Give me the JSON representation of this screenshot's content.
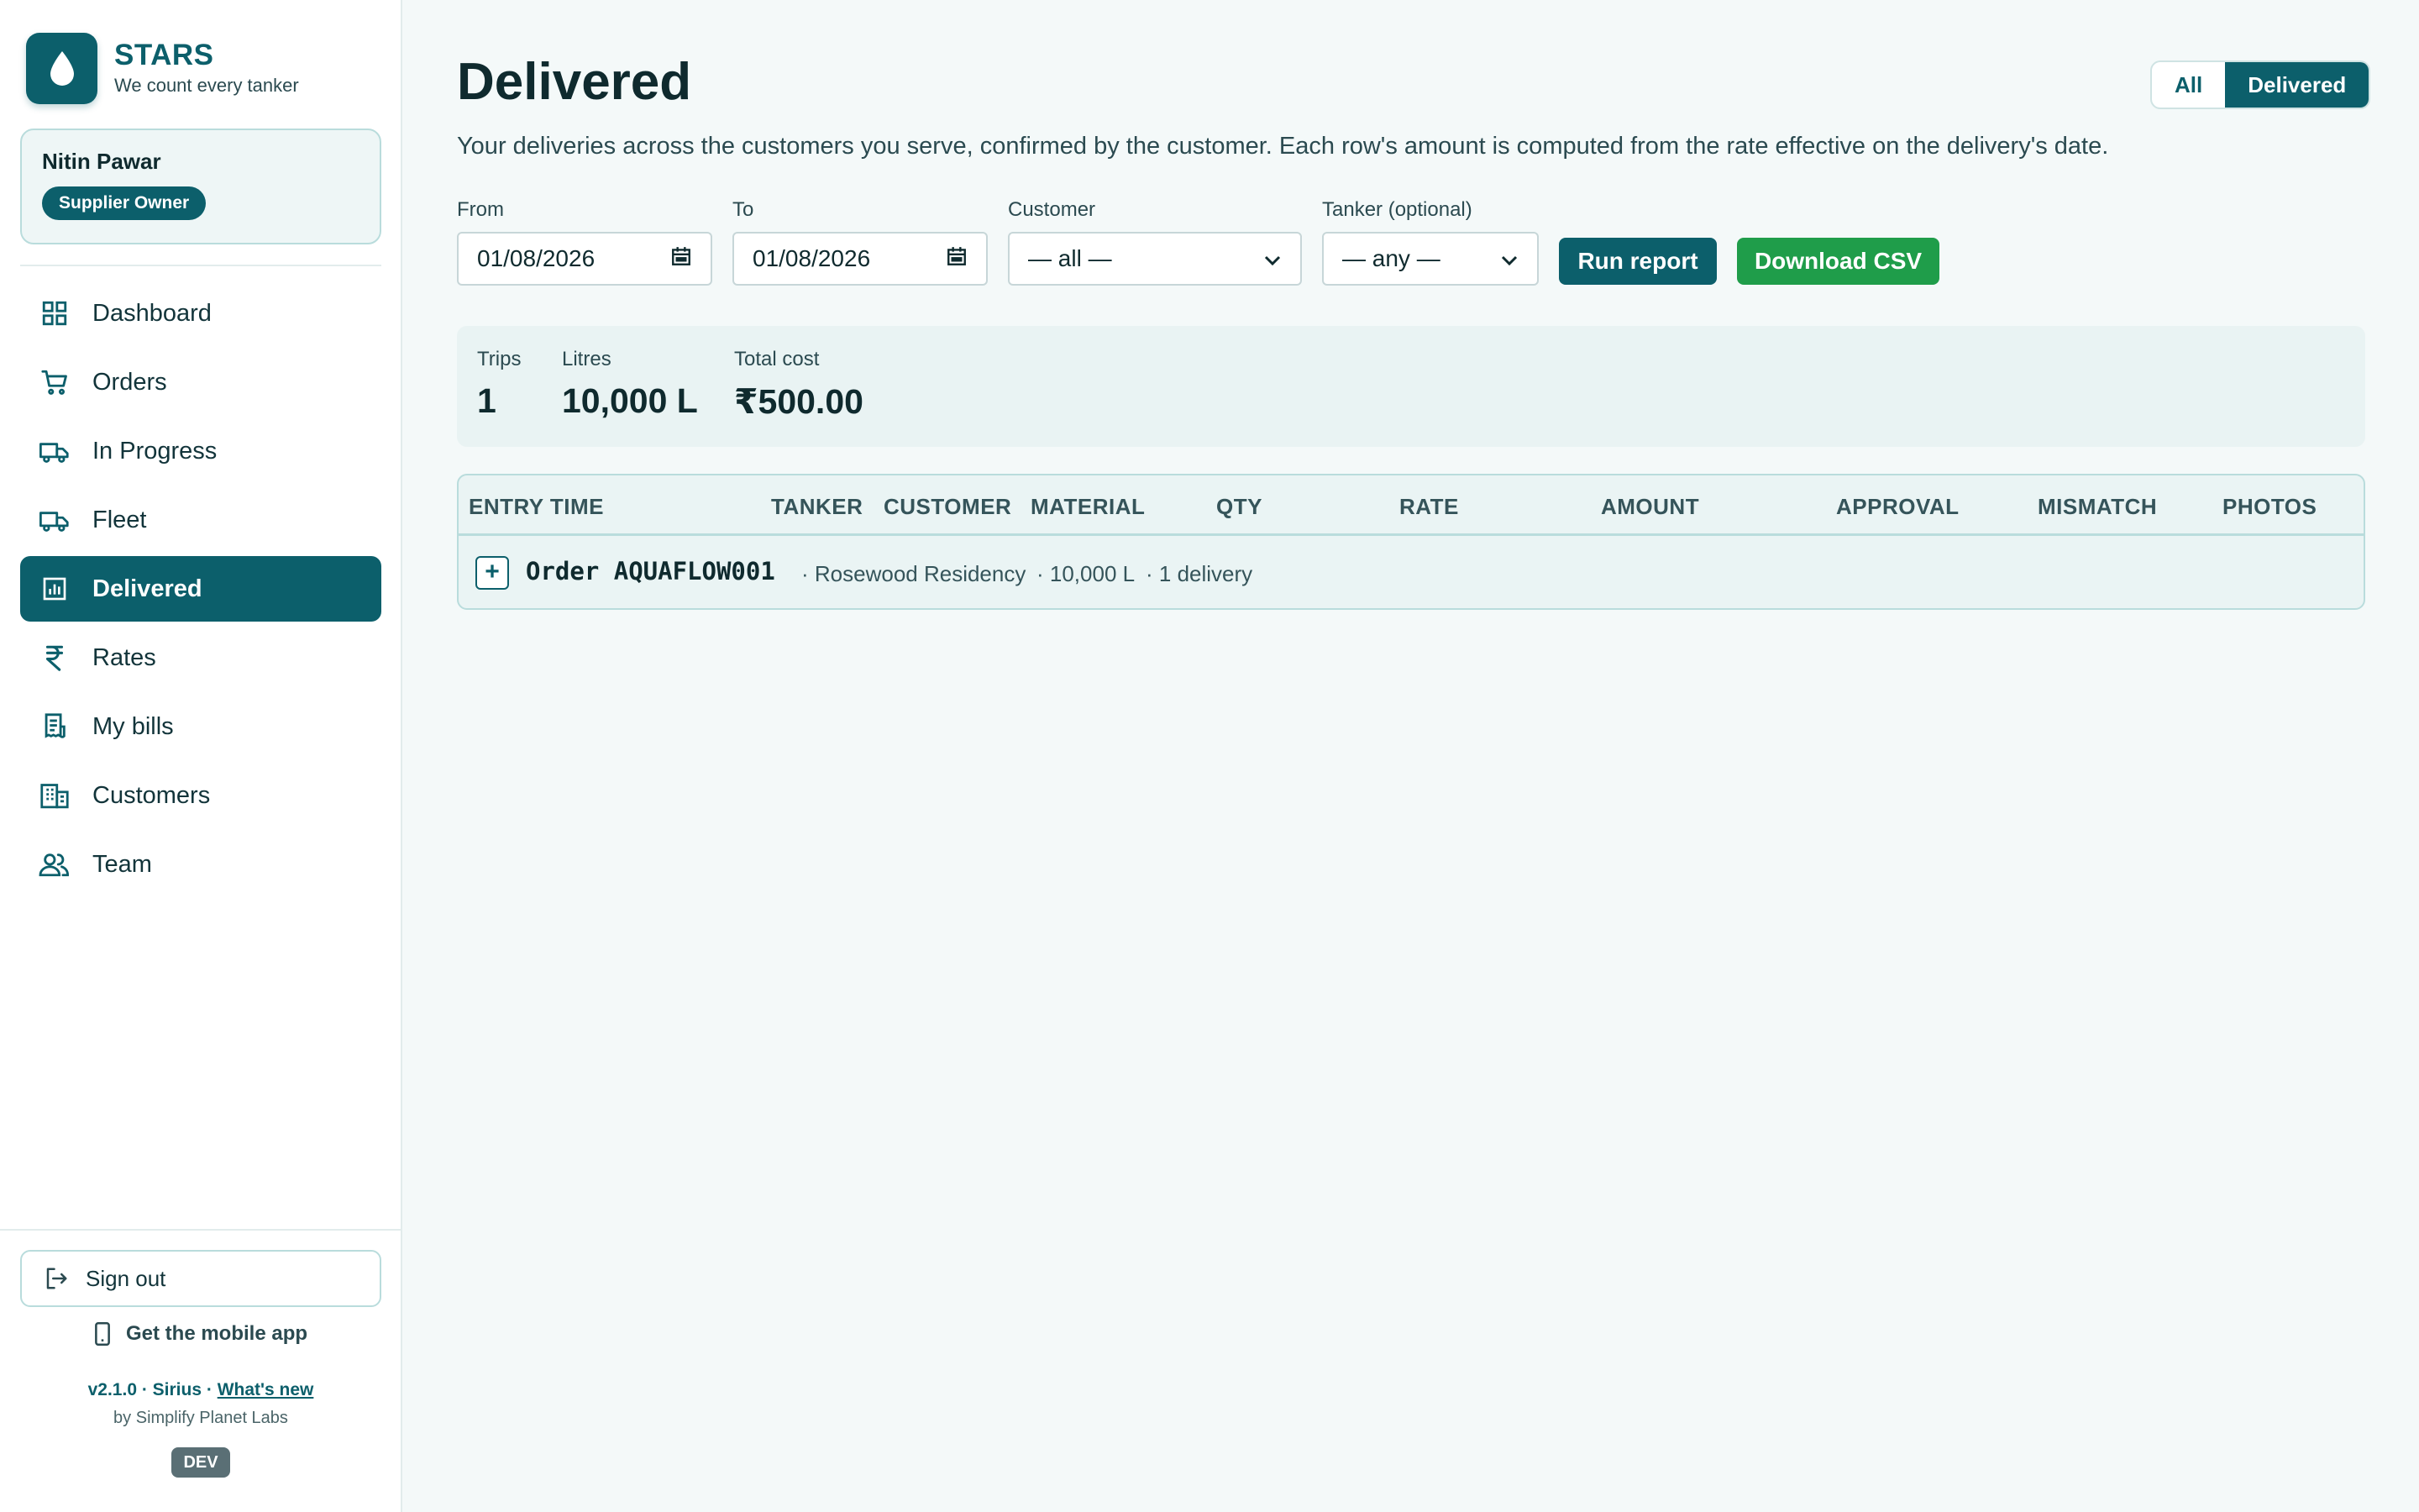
{
  "brand": {
    "name": "STARS",
    "tagline": "We count every tanker",
    "icon": "water-drop-icon"
  },
  "user": {
    "name": "Nitin Pawar",
    "role": "Supplier Owner"
  },
  "nav": [
    {
      "label": "Dashboard",
      "icon": "grid-icon",
      "active": false
    },
    {
      "label": "Orders",
      "icon": "cart-icon",
      "active": false
    },
    {
      "label": "In Progress",
      "icon": "truck-icon",
      "active": false
    },
    {
      "label": "Fleet",
      "icon": "truck-icon",
      "active": false
    },
    {
      "label": "Delivered",
      "icon": "bar-chart-icon",
      "active": true
    },
    {
      "label": "Rates",
      "icon": "rupee-icon",
      "active": false
    },
    {
      "label": "My bills",
      "icon": "receipt-icon",
      "active": false
    },
    {
      "label": "Customers",
      "icon": "building-icon",
      "active": false
    },
    {
      "label": "Team",
      "icon": "users-icon",
      "active": false
    }
  ],
  "footer": {
    "sign_out": "Sign out",
    "mobile_app": "Get the mobile app",
    "version": "v2.1.0",
    "sep": " · ",
    "release": "Sirius",
    "whats_new": "What's new",
    "byline": "by Simplify Planet Labs",
    "env": "DEV"
  },
  "page": {
    "title": "Delivered",
    "subtitle": "Your deliveries across the customers you serve, confirmed by the customer. Each row's amount is computed from the rate effective on the delivery's date.",
    "toggle": {
      "all": "All",
      "delivered": "Delivered",
      "selected": "Delivered"
    }
  },
  "filters": {
    "from_label": "From",
    "from_value": "01/08/2026",
    "to_label": "To",
    "to_value": "01/08/2026",
    "customer_label": "Customer",
    "customer_value": "— all —",
    "tanker_label": "Tanker (optional)",
    "tanker_value": "— any —",
    "run": "Run report",
    "csv": "Download CSV"
  },
  "summary": {
    "trips_label": "Trips",
    "trips": "1",
    "litres_label": "Litres",
    "litres": "10,000 L",
    "cost_label": "Total cost",
    "cost": "₹500.00"
  },
  "table": {
    "columns": [
      "ENTRY TIME",
      "TANKER",
      "CUSTOMER",
      "MATERIAL",
      "QTY",
      "RATE",
      "AMOUNT",
      "APPROVAL",
      "MISMATCH",
      "PHOTOS"
    ],
    "group": {
      "expand": "+",
      "order": "Order AQUAFLOW001",
      "customer": "· Rosewood Residency",
      "qty": "· 10,000 L",
      "count": "· 1 delivery"
    }
  },
  "colors": {
    "primary": "#0c5f6b",
    "success": "#1f9d4a",
    "page_bg": "#f4f9f9"
  }
}
